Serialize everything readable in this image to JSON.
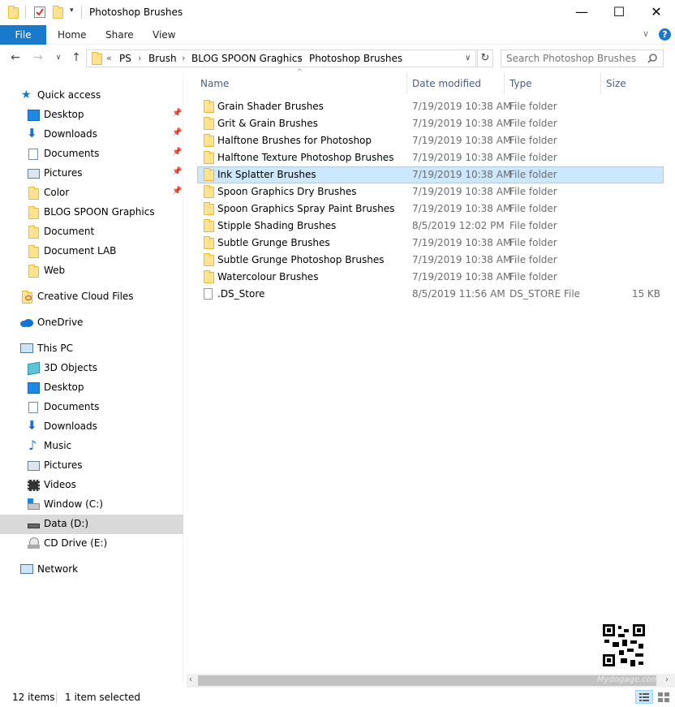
{
  "window": {
    "title": "Photoshop Brushes",
    "controls": {
      "minimize": "—",
      "maximize": "☐",
      "close": "✕"
    }
  },
  "ribbon": {
    "file": "File",
    "tabs": [
      "Home",
      "Share",
      "View"
    ],
    "help": "?"
  },
  "address": {
    "overflow": "«",
    "crumbs": [
      "PS",
      "Brush",
      "BLOG SPOON Graghics",
      "Photoshop Brushes"
    ]
  },
  "search": {
    "placeholder": "Search Photoshop Brushes"
  },
  "sidebar": {
    "quick_access": "Quick access",
    "quick_items": [
      "Desktop",
      "Downloads",
      "Documents",
      "Pictures",
      "Color",
      "BLOG SPOON Graphics",
      "Document",
      "Document LAB",
      "Web"
    ],
    "creative_cloud": "Creative Cloud Files",
    "onedrive": "OneDrive",
    "this_pc": "This PC",
    "pc_items": [
      "3D Objects",
      "Desktop",
      "Documents",
      "Downloads",
      "Music",
      "Pictures",
      "Videos",
      "Window (C:)",
      "Data (D:)",
      "CD Drive (E:)"
    ],
    "network": "Network"
  },
  "columns": {
    "name": "Name",
    "date": "Date modified",
    "type": "Type",
    "size": "Size"
  },
  "files": [
    {
      "name": "Grain Shader Brushes",
      "date": "7/19/2019 10:38 AM",
      "type": "File folder",
      "size": ""
    },
    {
      "name": "Grit & Grain Brushes",
      "date": "7/19/2019 10:38 AM",
      "type": "File folder",
      "size": ""
    },
    {
      "name": "Halftone Brushes for Photoshop",
      "date": "7/19/2019 10:38 AM",
      "type": "File folder",
      "size": ""
    },
    {
      "name": "Halftone Texture Photoshop Brushes",
      "date": "7/19/2019 10:38 AM",
      "type": "File folder",
      "size": ""
    },
    {
      "name": "Ink Splatter Brushes",
      "date": "7/19/2019 10:38 AM",
      "type": "File folder",
      "size": ""
    },
    {
      "name": "Spoon Graphics Dry Brushes",
      "date": "7/19/2019 10:38 AM",
      "type": "File folder",
      "size": ""
    },
    {
      "name": "Spoon Graphics Spray Paint Brushes",
      "date": "7/19/2019 10:38 AM",
      "type": "File folder",
      "size": ""
    },
    {
      "name": "Stipple Shading Brushes",
      "date": "8/5/2019 12:02 PM",
      "type": "File folder",
      "size": ""
    },
    {
      "name": "Subtle Grunge Brushes",
      "date": "7/19/2019 10:38 AM",
      "type": "File folder",
      "size": ""
    },
    {
      "name": "Subtle Grunge Photoshop Brushes",
      "date": "7/19/2019 10:38 AM",
      "type": "File folder",
      "size": ""
    },
    {
      "name": "Watercolour Brushes",
      "date": "7/19/2019 10:38 AM",
      "type": "File folder",
      "size": ""
    },
    {
      "name": ".DS_Store",
      "date": "8/5/2019 11:56 AM",
      "type": "DS_STORE File",
      "size": "15 KB"
    }
  ],
  "status": {
    "count": "12 items",
    "selected": "1 item selected"
  },
  "watermark": "Mydogage.com",
  "colors": {
    "accent": "#1979CA",
    "selection": "#CCE8FF",
    "folder": "#FFE38F"
  }
}
